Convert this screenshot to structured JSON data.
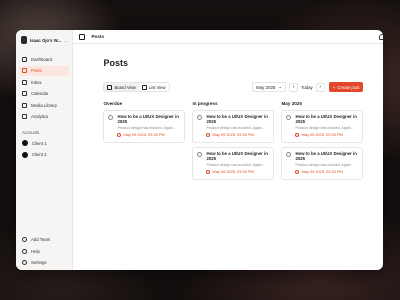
{
  "workspace": {
    "name": "Isaac Ojo's W...",
    "avatar_icon": "avatar"
  },
  "sidebar": {
    "items": [
      {
        "label": "Dashboard",
        "icon": "grid-icon"
      },
      {
        "label": "Posts",
        "icon": "document-icon",
        "active": true
      },
      {
        "label": "Inbox",
        "icon": "inbox-icon"
      },
      {
        "label": "Calendar",
        "icon": "calendar-icon"
      },
      {
        "label": "Media Library",
        "icon": "image-icon"
      },
      {
        "label": "Analytics",
        "icon": "chart-icon"
      }
    ],
    "accounts_label": "Accounts",
    "clients": [
      {
        "label": "Client 1"
      },
      {
        "label": "Client 2"
      }
    ],
    "bottom": [
      {
        "label": "Add Team"
      },
      {
        "label": "Help"
      },
      {
        "label": "Settings"
      }
    ]
  },
  "topbar": {
    "breadcrumb": "Posts"
  },
  "page": {
    "title": "Posts"
  },
  "toolbar": {
    "board_view": "Board View",
    "list_view": "List View",
    "month": "May 2025",
    "prev": "‹",
    "next": "›",
    "today": "Today",
    "create": "Create post"
  },
  "columns": [
    {
      "title": "Overdue",
      "cards": [
        {
          "title": "How to be a UI/UX Designer in 2025",
          "desc": "Product design has evolved. Again...",
          "date": "May 09 2025, 03:30 PM"
        }
      ]
    },
    {
      "title": "In progress",
      "cards": [
        {
          "title": "How to be a UI/UX Designer in 2025",
          "desc": "Product design has evolved. Again...",
          "date": "May 09 2025, 03:30 PM"
        },
        {
          "title": "How to be a UI/UX Designer in 2025",
          "desc": "Product design has evolved. Again...",
          "date": "May 09 2025, 03:30 PM"
        }
      ]
    },
    {
      "title": "May 2025",
      "cards": [
        {
          "title": "How to be a UI/UX Designer in 2025",
          "desc": "Product design has evolved. Again...",
          "date": "May 09 2025, 03:30 PM"
        },
        {
          "title": "How to be a UI/UX Designer in 2025",
          "desc": "Product design has evolved. Again...",
          "date": "May 09 2025, 03:30 PM"
        }
      ]
    }
  ],
  "colors": {
    "accent": "#e4482a",
    "sidebar_bg": "#f6f5f3"
  }
}
